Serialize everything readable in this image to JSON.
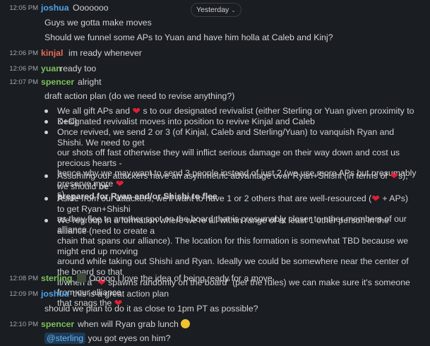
{
  "date_divider": {
    "label": "Yesterday"
  },
  "colors": {
    "joshua": "#4fa2e8",
    "kinjal": "#e36c58",
    "yuan": "#7cc15b",
    "spencer": "#7cc15b",
    "sterling": "#7cc15b"
  },
  "m1": {
    "time": "12:05 PM",
    "user": "joshua",
    "text": "Ooooooo"
  },
  "m1b": {
    "text": "Guys we gotta make moves"
  },
  "m1c": {
    "text": "Should we funnel some APs to Yuan and have him holla at Caleb and Kinj?"
  },
  "m2": {
    "time": "12:06 PM",
    "user": "kinjal",
    "text": "im ready whenever"
  },
  "m3": {
    "time": "12:06 PM",
    "user": "yuan",
    "text": "ready too"
  },
  "m4": {
    "time": "12:07 PM",
    "user": "spencer",
    "text": "alright"
  },
  "m4b": {
    "text": "draft action plan (do we need to revise anything?)"
  },
  "plan": {
    "b1a": "We all gift APs and ",
    "b1b": " s to our designated revivalist (either Sterling or Yuan given proximity to K+C)",
    "b2": "Designated revivalist moves into position to revive Kinjal and Caleb",
    "b3a": "Once revived, we send 2 or 3 (of Kinjal, Caleb and Sterling/Yuan) to vanquish Ryan and Shishi. We need to get",
    "b3b": "our shots off fast otherwise they will inflict serious damage on their way down and cost us precious hearts -",
    "b3c": "hence why we may want to send 3 people instead of just 2 (we use more APs but presumably preserve more ",
    "b3d": "s)",
    "b4a": "Assuming our attackers have an asymmetric advantage over Ryan+Shishi (in terms of ",
    "b4b": "s), we should ",
    "b4c": "be",
    "b4d": "prepared for Ryan and/or Shishi to flee",
    "b5a": "Aside from our attackers, we'll want to have 1 or 2 others that are well-resourced (",
    "b5b": " + APs) to get Ryan+Shishi",
    "b5c": "as they flee to another spot on the board that is presumably closer to other members of our alliance.",
    "b6a": "We regroup in a formation where we're all within range of at least 1 other person in the alliance (need to create a",
    "b6b": "chain that spans our alliance). The location for this formation is somewhat TBD because we might end up moving",
    "b6c": "around while taking out Shishi and Ryan. Ideally we could be somewhere near the center of the board so that",
    "b6d": "if/when a \"",
    "b6e": " spawns randomly on the board\" (per the rules) we can make sure it's someone from our alliance",
    "b6f": "that snags the "
  },
  "m5": {
    "time": "12:08 PM",
    "user": "sterling",
    "text": "Ooooo I love the idea of being ready for a move"
  },
  "m6": {
    "time": "12:09 PM",
    "user": "joshua",
    "text": "this is a great action plan"
  },
  "m6b": {
    "text": "should we plan to do it as close to 1pm PT as possible?"
  },
  "m7": {
    "time": "12:10 PM",
    "user": "spencer",
    "text": "when will Ryan grab lunch"
  },
  "m7b": {
    "mention": "@sterling",
    "text": " you got eyes on him?"
  }
}
